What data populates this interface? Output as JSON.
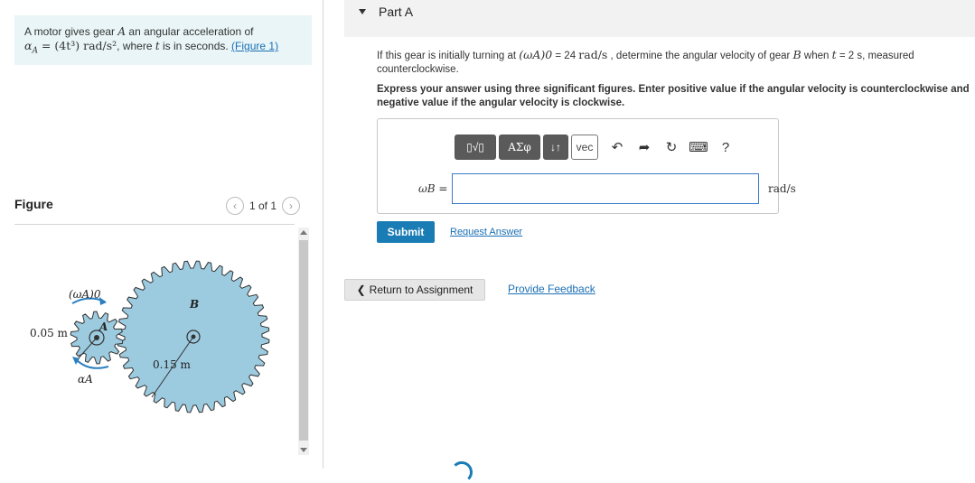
{
  "problem": {
    "line1_prefix": "A motor gives gear ",
    "gear_a": "A",
    "line1_suffix": " an angular acceleration of",
    "alpha_expr_lhs": "α",
    "alpha_sub": "A",
    "alpha_expr_rhs": " = (4t³) rad/s²",
    "line2_suffix": ", where ",
    "t_var": "t",
    "line2_end": " is in seconds. ",
    "figure_link": "(Figure 1)"
  },
  "figure": {
    "title": "Figure",
    "pager_text": "1 of 1",
    "prev_icon": "chevron-left-icon",
    "next_icon": "chevron-right-icon",
    "labels": {
      "omega_a0": "(ωA)0",
      "gear_a": "A",
      "gear_b": "B",
      "radius_a": "0.05 m",
      "radius_b": "0.15 m",
      "alpha_a": "αA"
    },
    "colors": {
      "gear_fill": "#9ccbe0",
      "gear_stroke": "#333333",
      "arrow": "#2b7fc0"
    }
  },
  "part": {
    "title": "Part A",
    "question_a": "If this gear is initially turning at ",
    "question_omega": "(ωA)0",
    "question_b": " = 24 ",
    "question_units": "rad/s",
    "question_c": " , determine the angular velocity of gear ",
    "question_gear": "B",
    "question_d": " when ",
    "question_t": "t",
    "question_e": " = 2 s, measured counterclockwise.",
    "instructions": "Express your answer using three significant figures. Enter positive value if the angular velocity is counterclockwise and negative value if the angular velocity is clockwise."
  },
  "toolbar": {
    "template_btn": "▯√▯",
    "greek_btn": "ΑΣφ",
    "arrows_btn": "↓↑",
    "vec_btn": "vec",
    "undo_icon": "undo-icon",
    "redo_icon": "redo-icon",
    "reset_icon": "reset-icon",
    "keyboard_icon": "keyboard-icon",
    "help_label": "?"
  },
  "answer": {
    "label": "ωB =",
    "value": "",
    "unit": "rad/s"
  },
  "actions": {
    "submit": "Submit",
    "request": "Request Answer",
    "return": "Return to Assignment",
    "feedback": "Provide Feedback"
  }
}
